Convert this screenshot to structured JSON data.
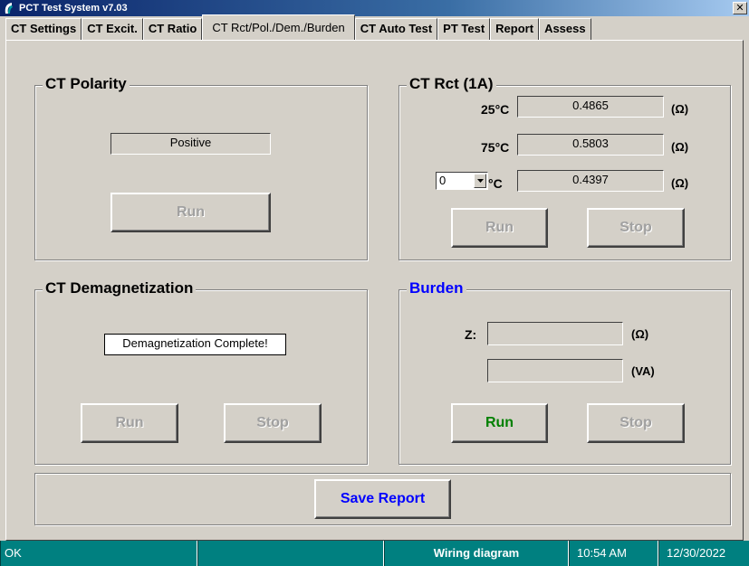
{
  "window": {
    "title": "PCT Test System v7.03",
    "close_glyph": "✕"
  },
  "tabs": [
    {
      "label": "CT Settings"
    },
    {
      "label": "CT Excit."
    },
    {
      "label": "CT Ratio"
    },
    {
      "label": "CT Rct/Pol./Dem./Burden"
    },
    {
      "label": "CT Auto Test"
    },
    {
      "label": "PT Test"
    },
    {
      "label": "Report"
    },
    {
      "label": "Assess"
    }
  ],
  "polarity": {
    "title": "CT Polarity",
    "result": "Positive",
    "run_label": "Run"
  },
  "rct": {
    "title": "CT Rct (1A)",
    "rows": [
      {
        "temp": "25°C",
        "value": "0.4865",
        "unit": "(Ω)"
      },
      {
        "temp": "75°C",
        "value": "0.5803",
        "unit": "(Ω)"
      },
      {
        "temp": "°C",
        "value": "0.4397",
        "unit": "(Ω)"
      }
    ],
    "custom_temp_value": "0",
    "run_label": "Run",
    "stop_label": "Stop"
  },
  "demag": {
    "title": "CT Demagnetization",
    "result": "Demagnetization Complete!",
    "run_label": "Run",
    "stop_label": "Stop"
  },
  "burden": {
    "title": "Burden",
    "z_label": "Z:",
    "z_value": "",
    "z_unit": "(Ω)",
    "va_value": "",
    "va_unit": "(VA)",
    "run_label": "Run",
    "stop_label": "Stop"
  },
  "save_report_label": "Save Report",
  "status": {
    "state": "OK",
    "blank": "",
    "wiring": "Wiring diagram",
    "time": "10:54 AM",
    "date": "12/30/2022"
  },
  "colors": {
    "status_bar": "#008080",
    "accent_blue": "#0000ff",
    "run_green": "#008000"
  }
}
